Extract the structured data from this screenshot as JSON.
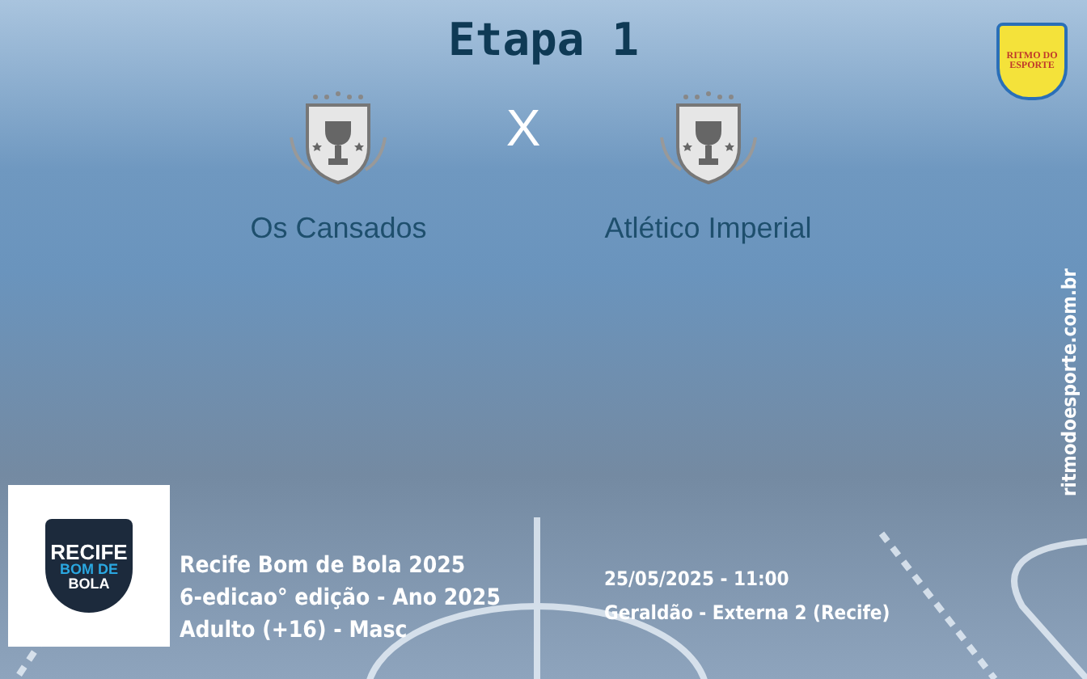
{
  "title": "Etapa 1",
  "teams": [
    {
      "name": "Os Cansados"
    },
    {
      "name": "Atlético Imperial"
    }
  ],
  "versus": "X",
  "brand": {
    "logo_lines": [
      "RITMO DO",
      "ESPORTE"
    ],
    "site": "ritmodoesporte.com.br"
  },
  "tournament": {
    "logo_lines": [
      "RECIFE",
      "BOM DE",
      "BOLA"
    ],
    "lines": [
      "Recife Bom de Bola 2025",
      "6-edicao° edição - Ano 2025",
      "Adulto (+16) - Masc"
    ]
  },
  "match": {
    "datetime": "25/05/2025 - 11:00",
    "venue": "Geraldão - Externa 2 (Recife)"
  }
}
